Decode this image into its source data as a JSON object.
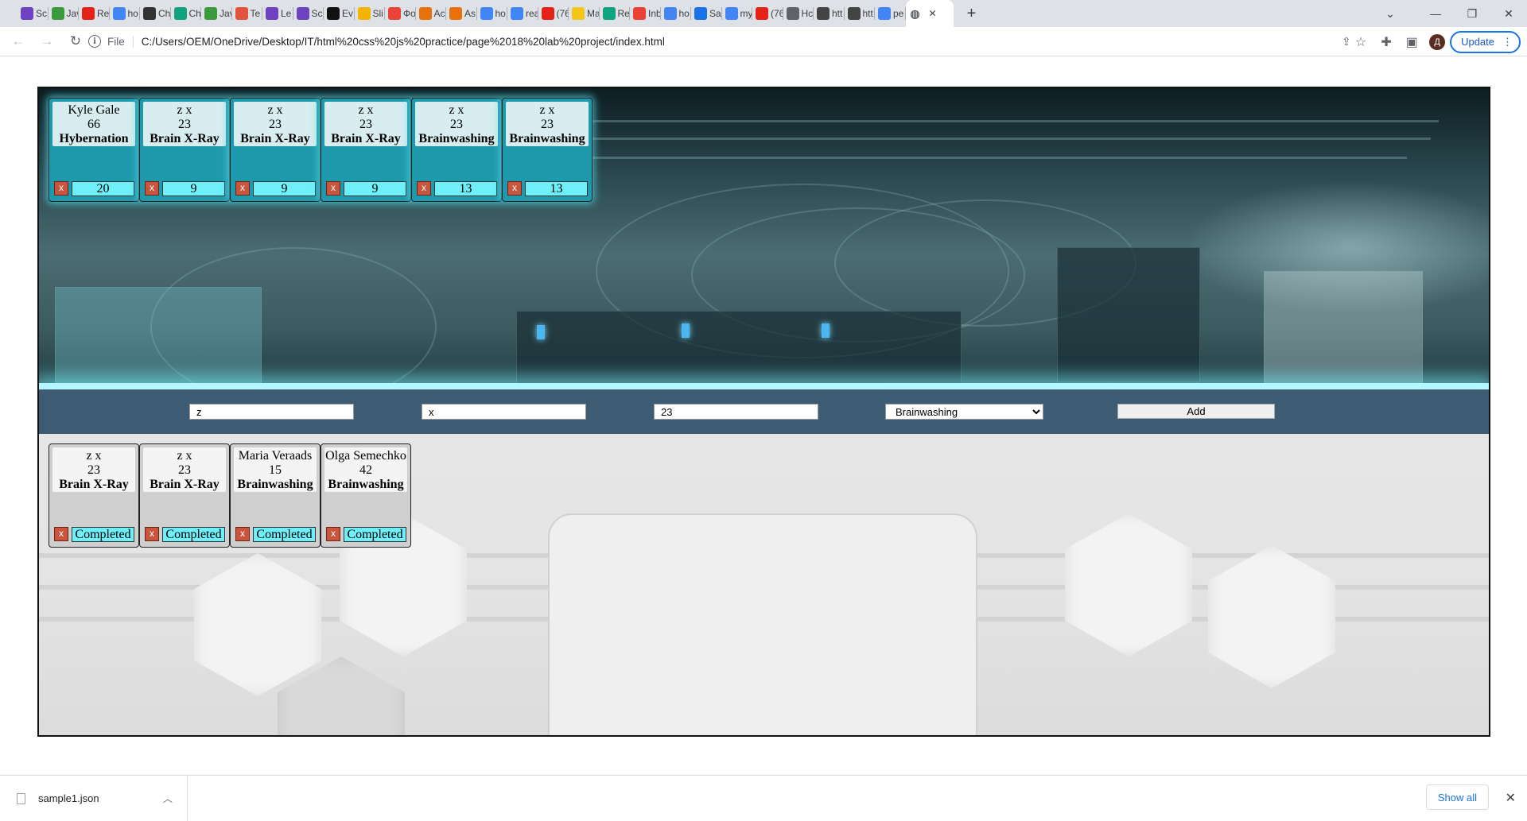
{
  "browser": {
    "tabs": [
      {
        "label": "Sc",
        "icon": "page-icon",
        "color": "#6f42c1"
      },
      {
        "label": "Jav",
        "icon": "w-icon",
        "color": "#3a9b3a"
      },
      {
        "label": "Re",
        "icon": "youtube-icon",
        "color": "#e62117"
      },
      {
        "label": "ho",
        "icon": "google-icon",
        "color": "#4285f4"
      },
      {
        "label": "Ch",
        "icon": "chatgpt-icon",
        "color": "#333333"
      },
      {
        "label": "Ch",
        "icon": "chatgpt-icon",
        "color": "#10a37f"
      },
      {
        "label": "Jav",
        "icon": "w-icon",
        "color": "#3a9b3a"
      },
      {
        "label": "Te",
        "icon": "page-icon",
        "color": "#e2533c"
      },
      {
        "label": "Le",
        "icon": "page-icon",
        "color": "#6f42c1"
      },
      {
        "label": "Sc",
        "icon": "page-icon",
        "color": "#6f42c1"
      },
      {
        "label": "Ev",
        "icon": "m-icon",
        "color": "#111111"
      },
      {
        "label": "Sli",
        "icon": "drive-icon",
        "color": "#f4b400"
      },
      {
        "label": "Фо",
        "icon": "photos-icon",
        "color": "#ea4335"
      },
      {
        "label": "Ac",
        "icon": "a-icon",
        "color": "#e8710a"
      },
      {
        "label": "As",
        "icon": "a-icon",
        "color": "#e8710a"
      },
      {
        "label": "ho",
        "icon": "google-icon",
        "color": "#4285f4"
      },
      {
        "label": "rea",
        "icon": "google-icon",
        "color": "#4285f4"
      },
      {
        "label": "(76",
        "icon": "youtube-icon",
        "color": "#e62117"
      },
      {
        "label": "Ma",
        "icon": "bolt-icon",
        "color": "#f5c518"
      },
      {
        "label": "Re",
        "icon": "chatgpt-icon",
        "color": "#10a37f"
      },
      {
        "label": "Inb",
        "icon": "gmail-icon",
        "color": "#ea4335"
      },
      {
        "label": "ho",
        "icon": "google-icon",
        "color": "#4285f4"
      },
      {
        "label": "Sa",
        "icon": "s-icon",
        "color": "#1a73e8"
      },
      {
        "label": "my",
        "icon": "google-icon",
        "color": "#4285f4"
      },
      {
        "label": "(76",
        "icon": "youtube-icon",
        "color": "#e62117"
      },
      {
        "label": "Hc",
        "icon": "h-icon",
        "color": "#5f6368"
      },
      {
        "label": "htt",
        "icon": "robot-icon",
        "color": "#444444"
      },
      {
        "label": "htt",
        "icon": "robot-icon",
        "color": "#444444"
      },
      {
        "label": "pe",
        "icon": "google-icon",
        "color": "#4285f4"
      }
    ],
    "active_tab_icon": "globe-icon",
    "new_tab": "+",
    "address": {
      "scheme": "File",
      "url": "C:/Users/OEM/OneDrive/Desktop/IT/html%20css%20js%20practice/page%2018%20lab%20project/index.html"
    },
    "avatar_letter": "Д",
    "update_label": "Update"
  },
  "queue_cards": [
    {
      "name": "Kyle Gale",
      "age": "66",
      "procedure": "Hybernation",
      "remove": "x",
      "time": "20"
    },
    {
      "name": "z x",
      "age": "23",
      "procedure": "Brain X-Ray",
      "remove": "x",
      "time": "9"
    },
    {
      "name": "z x",
      "age": "23",
      "procedure": "Brain X-Ray",
      "remove": "x",
      "time": "9"
    },
    {
      "name": "z x",
      "age": "23",
      "procedure": "Brain X-Ray",
      "remove": "x",
      "time": "9"
    },
    {
      "name": "z x",
      "age": "23",
      "procedure": "Brainwashing",
      "remove": "x",
      "time": "13"
    },
    {
      "name": "z x",
      "age": "23",
      "procedure": "Brainwashing",
      "remove": "x",
      "time": "13"
    }
  ],
  "form": {
    "first_name": "z",
    "last_name": "x",
    "age": "23",
    "procedure_selected": "Brainwashing",
    "add_label": "Add"
  },
  "done_cards": [
    {
      "name": "z x",
      "age": "23",
      "procedure": "Brain X-Ray",
      "remove": "x",
      "status": "Completed"
    },
    {
      "name": "z x",
      "age": "23",
      "procedure": "Brain X-Ray",
      "remove": "x",
      "status": "Completed"
    },
    {
      "name": "Maria Veraads",
      "age": "15",
      "procedure": "Brainwashing",
      "remove": "x",
      "status": "Completed"
    },
    {
      "name": "Olga Semechko",
      "age": "42",
      "procedure": "Brainwashing",
      "remove": "x",
      "status": "Completed"
    }
  ],
  "downloads": {
    "file": "sample1.json",
    "show_all": "Show all"
  }
}
